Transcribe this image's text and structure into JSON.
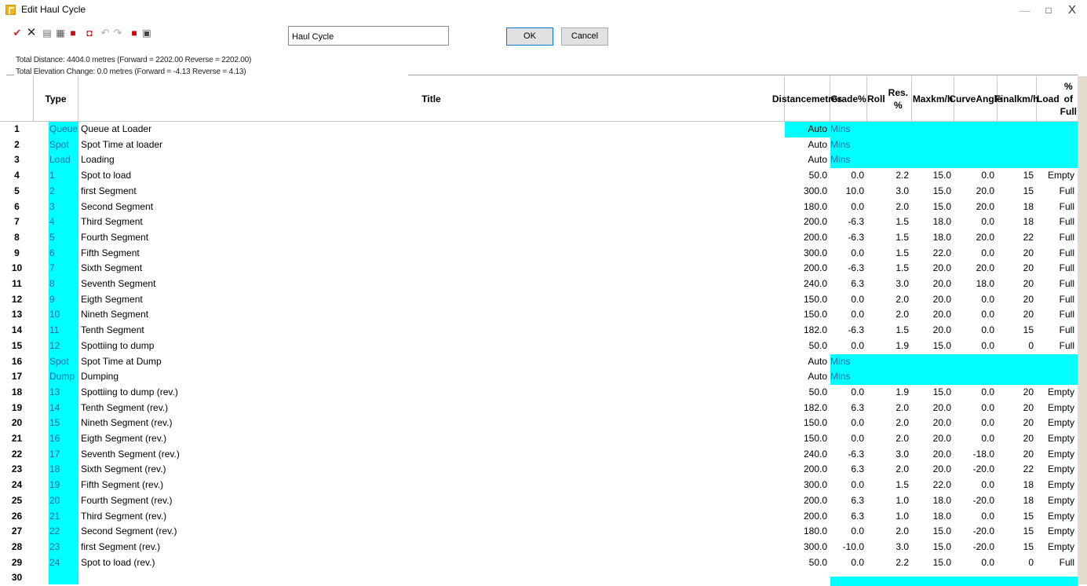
{
  "window": {
    "title": "Edit Haul Cycle",
    "controls": {
      "minimize": "—",
      "maximize": "□",
      "close": "X"
    }
  },
  "toolbar": {
    "icons": [
      "accept-icon",
      "delete-icon",
      "copy-icon",
      "paste-icon",
      "book-icon",
      "marker-icon",
      "undo-icon",
      "redo-icon",
      "save-icon",
      "print-icon"
    ],
    "name_value": "Haul Cycle",
    "ok_label": "OK",
    "cancel_label": "Cancel"
  },
  "summary": {
    "distance": "Total Distance: 4404.0 metres (Forward = 2202.00 Reverse = 2202.00)",
    "elevation": "Total Elevation Change: 0.0 metres (Forward = -4.13 Reverse = 4.13)"
  },
  "columns": {
    "type": "Type",
    "title": "Title",
    "distance": [
      "Distance",
      "metres"
    ],
    "grade": [
      "Grade",
      "%"
    ],
    "roll": [
      "Roll",
      "Res. %"
    ],
    "max": [
      "Max",
      "km/h"
    ],
    "curve": [
      "Curve",
      "Angle"
    ],
    "final": [
      "Final",
      "km/h"
    ],
    "load": [
      "Load",
      "% of Full"
    ]
  },
  "colors": {
    "highlight": "#00ffff",
    "type_text": "#0070b0"
  },
  "rows": [
    {
      "n": "1",
      "type": "Queue",
      "title": "Queue at Loader",
      "dist": "Auto",
      "grade": "Mins",
      "roll": "",
      "max": "",
      "curve": "",
      "final": "",
      "load": "",
      "cyan_dist": true
    },
    {
      "n": "2",
      "type": "Spot",
      "title": "Spot Time at loader",
      "dist": "Auto",
      "grade": "Mins",
      "roll": "",
      "max": "",
      "curve": "",
      "final": "",
      "load": ""
    },
    {
      "n": "3",
      "type": "Load",
      "title": "Loading",
      "dist": "Auto",
      "grade": "Mins",
      "roll": "",
      "max": "",
      "curve": "",
      "final": "",
      "load": ""
    },
    {
      "n": "4",
      "type": "1",
      "title": "Spot to load",
      "dist": "50.0",
      "grade": "0.0",
      "roll": "2.2",
      "max": "15.0",
      "curve": "0.0",
      "final": "15",
      "load": "Empty"
    },
    {
      "n": "5",
      "type": "2",
      "title": "first Segment",
      "dist": "300.0",
      "grade": "10.0",
      "roll": "3.0",
      "max": "15.0",
      "curve": "20.0",
      "final": "15",
      "load": "Full"
    },
    {
      "n": "6",
      "type": "3",
      "title": "Second Segment",
      "dist": "180.0",
      "grade": "0.0",
      "roll": "2.0",
      "max": "15.0",
      "curve": "20.0",
      "final": "18",
      "load": "Full"
    },
    {
      "n": "7",
      "type": "4",
      "title": "Third Segment",
      "dist": "200.0",
      "grade": "-6.3",
      "roll": "1.5",
      "max": "18.0",
      "curve": "0.0",
      "final": "18",
      "load": "Full"
    },
    {
      "n": "8",
      "type": "5",
      "title": "Fourth Segment",
      "dist": "200.0",
      "grade": "-6.3",
      "roll": "1.5",
      "max": "18.0",
      "curve": "20.0",
      "final": "22",
      "load": "Full"
    },
    {
      "n": "9",
      "type": "6",
      "title": "Fifth Segment",
      "dist": "300.0",
      "grade": "0.0",
      "roll": "1.5",
      "max": "22.0",
      "curve": "0.0",
      "final": "20",
      "load": "Full"
    },
    {
      "n": "10",
      "type": "7",
      "title": "Sixth Segment",
      "dist": "200.0",
      "grade": "-6.3",
      "roll": "1.5",
      "max": "20.0",
      "curve": "20.0",
      "final": "20",
      "load": "Full"
    },
    {
      "n": "11",
      "type": "8",
      "title": "Seventh Segment",
      "dist": "240.0",
      "grade": "6.3",
      "roll": "3.0",
      "max": "20.0",
      "curve": "18.0",
      "final": "20",
      "load": "Full"
    },
    {
      "n": "12",
      "type": "9",
      "title": "Eigth Segment",
      "dist": "150.0",
      "grade": "0.0",
      "roll": "2.0",
      "max": "20.0",
      "curve": "0.0",
      "final": "20",
      "load": "Full"
    },
    {
      "n": "13",
      "type": "10",
      "title": "Nineth Segment",
      "dist": "150.0",
      "grade": "0.0",
      "roll": "2.0",
      "max": "20.0",
      "curve": "0.0",
      "final": "20",
      "load": "Full"
    },
    {
      "n": "14",
      "type": "11",
      "title": "Tenth Segment",
      "dist": "182.0",
      "grade": "-6.3",
      "roll": "1.5",
      "max": "20.0",
      "curve": "0.0",
      "final": "15",
      "load": "Full"
    },
    {
      "n": "15",
      "type": "12",
      "title": "Spottiing to dump",
      "dist": "50.0",
      "grade": "0.0",
      "roll": "1.9",
      "max": "15.0",
      "curve": "0.0",
      "final": "0",
      "load": "Full"
    },
    {
      "n": "16",
      "type": "Spot",
      "title": "Spot Time at Dump",
      "dist": "Auto",
      "grade": "Mins",
      "roll": "",
      "max": "",
      "curve": "",
      "final": "",
      "load": ""
    },
    {
      "n": "17",
      "type": "Dump",
      "title": "Dumping",
      "dist": "Auto",
      "grade": "Mins",
      "roll": "",
      "max": "",
      "curve": "",
      "final": "",
      "load": ""
    },
    {
      "n": "18",
      "type": "13",
      "title": "Spottiing to dump (rev.)",
      "dist": "50.0",
      "grade": "0.0",
      "roll": "1.9",
      "max": "15.0",
      "curve": "0.0",
      "final": "20",
      "load": "Empty"
    },
    {
      "n": "19",
      "type": "14",
      "title": "Tenth Segment (rev.)",
      "dist": "182.0",
      "grade": "6.3",
      "roll": "2.0",
      "max": "20.0",
      "curve": "0.0",
      "final": "20",
      "load": "Empty"
    },
    {
      "n": "20",
      "type": "15",
      "title": "Nineth Segment (rev.)",
      "dist": "150.0",
      "grade": "0.0",
      "roll": "2.0",
      "max": "20.0",
      "curve": "0.0",
      "final": "20",
      "load": "Empty"
    },
    {
      "n": "21",
      "type": "16",
      "title": "Eigth Segment (rev.)",
      "dist": "150.0",
      "grade": "0.0",
      "roll": "2.0",
      "max": "20.0",
      "curve": "0.0",
      "final": "20",
      "load": "Empty"
    },
    {
      "n": "22",
      "type": "17",
      "title": "Seventh Segment (rev.)",
      "dist": "240.0",
      "grade": "-6.3",
      "roll": "3.0",
      "max": "20.0",
      "curve": "-18.0",
      "final": "20",
      "load": "Empty"
    },
    {
      "n": "23",
      "type": "18",
      "title": "Sixth Segment (rev.)",
      "dist": "200.0",
      "grade": "6.3",
      "roll": "2.0",
      "max": "20.0",
      "curve": "-20.0",
      "final": "22",
      "load": "Empty"
    },
    {
      "n": "24",
      "type": "19",
      "title": "Fifth Segment (rev.)",
      "dist": "300.0",
      "grade": "0.0",
      "roll": "1.5",
      "max": "22.0",
      "curve": "0.0",
      "final": "18",
      "load": "Empty"
    },
    {
      "n": "25",
      "type": "20",
      "title": "Fourth Segment (rev.)",
      "dist": "200.0",
      "grade": "6.3",
      "roll": "1.0",
      "max": "18.0",
      "curve": "-20.0",
      "final": "18",
      "load": "Empty"
    },
    {
      "n": "26",
      "type": "21",
      "title": "Third Segment (rev.)",
      "dist": "200.0",
      "grade": "6.3",
      "roll": "1.0",
      "max": "18.0",
      "curve": "0.0",
      "final": "15",
      "load": "Empty"
    },
    {
      "n": "27",
      "type": "22",
      "title": "Second Segment (rev.)",
      "dist": "180.0",
      "grade": "0.0",
      "roll": "2.0",
      "max": "15.0",
      "curve": "-20.0",
      "final": "15",
      "load": "Empty"
    },
    {
      "n": "28",
      "type": "23",
      "title": "first Segment (rev.)",
      "dist": "300.0",
      "grade": "-10.0",
      "roll": "3.0",
      "max": "15.0",
      "curve": "-20.0",
      "final": "15",
      "load": "Empty"
    },
    {
      "n": "29",
      "type": "24",
      "title": "Spot to load (rev.)",
      "dist": "50.0",
      "grade": "0.0",
      "roll": "2.2",
      "max": "15.0",
      "curve": "0.0",
      "final": "0",
      "load": "Full"
    },
    {
      "n": "30",
      "type": "",
      "title": "",
      "dist": "",
      "grade": "",
      "roll": "",
      "max": "",
      "curve": "",
      "final": "",
      "load": ""
    }
  ]
}
